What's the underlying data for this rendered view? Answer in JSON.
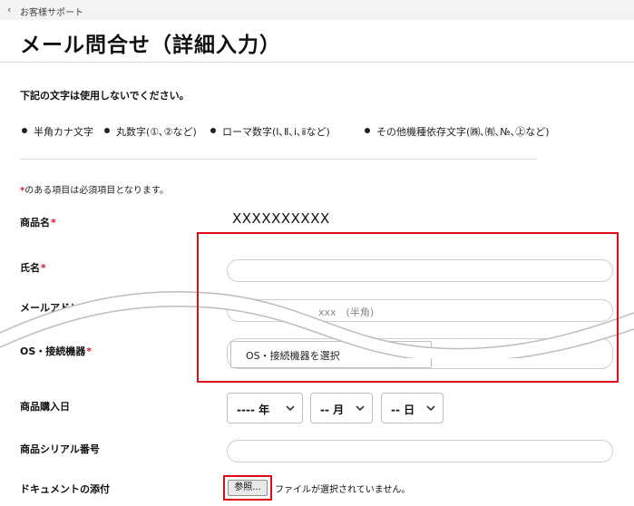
{
  "breadcrumb": {
    "back_icon": "chevron-left-icon",
    "label": "お客様サポート"
  },
  "page_title": "メール問合せ（詳細入力）",
  "notice": "下記の文字は使用しないでください。",
  "forbidden_chars": [
    "半角カナ文字",
    "丸数字(①､②など)",
    "ローマ数字(Ⅰ､Ⅱ､ⅰ､ⅱなど)",
    "その他機種依存文字(㈱､㈲､№､㊤など)"
  ],
  "required_note": {
    "mark": "*",
    "text": "のある項目は必須項目となります。"
  },
  "form": {
    "product_name": {
      "label": "商品名",
      "required": "*",
      "value": "XXXXXXXXXX"
    },
    "name": {
      "label": "氏名",
      "required": "*",
      "value": ""
    },
    "email": {
      "label": "メールアドレス",
      "required": "*",
      "placeholder": "xxx　(半角)"
    },
    "os_device": {
      "label": "OS・接続機器",
      "required": "*",
      "selected": "OS・接続機器を選択"
    },
    "purchase_date": {
      "label": "商品購入日",
      "year": "---- 年",
      "month": "-- 月",
      "day": "-- 日"
    },
    "serial": {
      "label": "商品シリアル番号",
      "value": ""
    },
    "attachment": {
      "label": "ドキュメントの添付",
      "button": "参照...",
      "status": "ファイルが選択されていません。"
    }
  },
  "colors": {
    "required": "#d9142b",
    "highlight": "#e00d19",
    "topbar": "#f3f3f3"
  }
}
